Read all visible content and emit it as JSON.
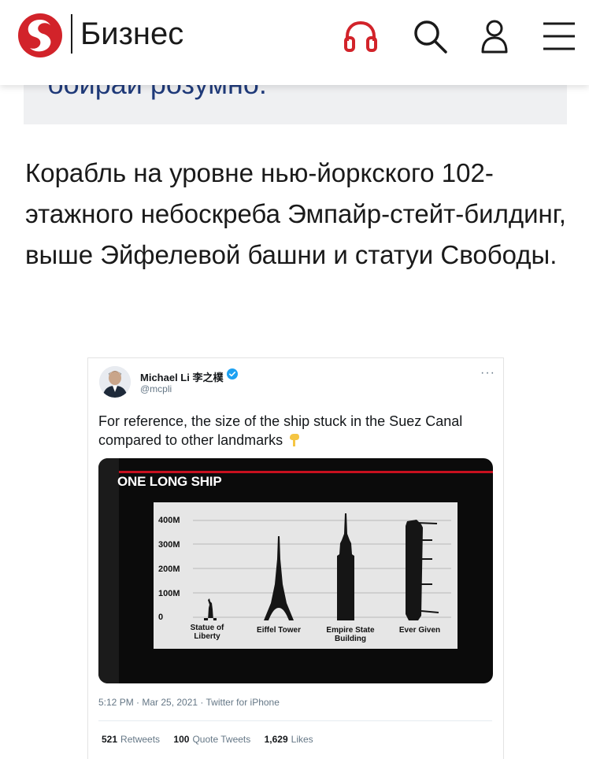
{
  "header": {
    "section_title": "Бизнес",
    "icons": [
      "logo-icon",
      "headphones-icon",
      "search-icon",
      "user-icon",
      "menu-icon"
    ],
    "brand_color": "#d2232a"
  },
  "promo": {
    "text": "бойрай розумно."
  },
  "article": {
    "paragraph": "Корабль на уровне нью-йоркского 102-этажного небоскреба Эмпайр-стейт-билдинг, выше Эйфелевой башни и статуи Свободы."
  },
  "tweet": {
    "author_name": "Michael Li 李之樸",
    "author_handle": "@mcpli",
    "more_label": "···",
    "text": "For reference, the size of the ship stuck in the Suez Canal compared to other landmarks",
    "media": {
      "title": "ONE LONG SHIP",
      "y_ticks": [
        "400M",
        "300M",
        "200M",
        "100M",
        "0"
      ],
      "landmarks": [
        "Statue of Liberty",
        "Eiffel Tower",
        "Empire State Building",
        "Ever Given"
      ]
    },
    "timestamp": "5:12 PM · Mar 25, 2021 · Twitter for iPhone",
    "stats": {
      "retweets_count": "521",
      "retweets_label": "Retweets",
      "quotes_count": "100",
      "quotes_label": "Quote Tweets",
      "likes_count": "1,629",
      "likes_label": "Likes"
    }
  }
}
